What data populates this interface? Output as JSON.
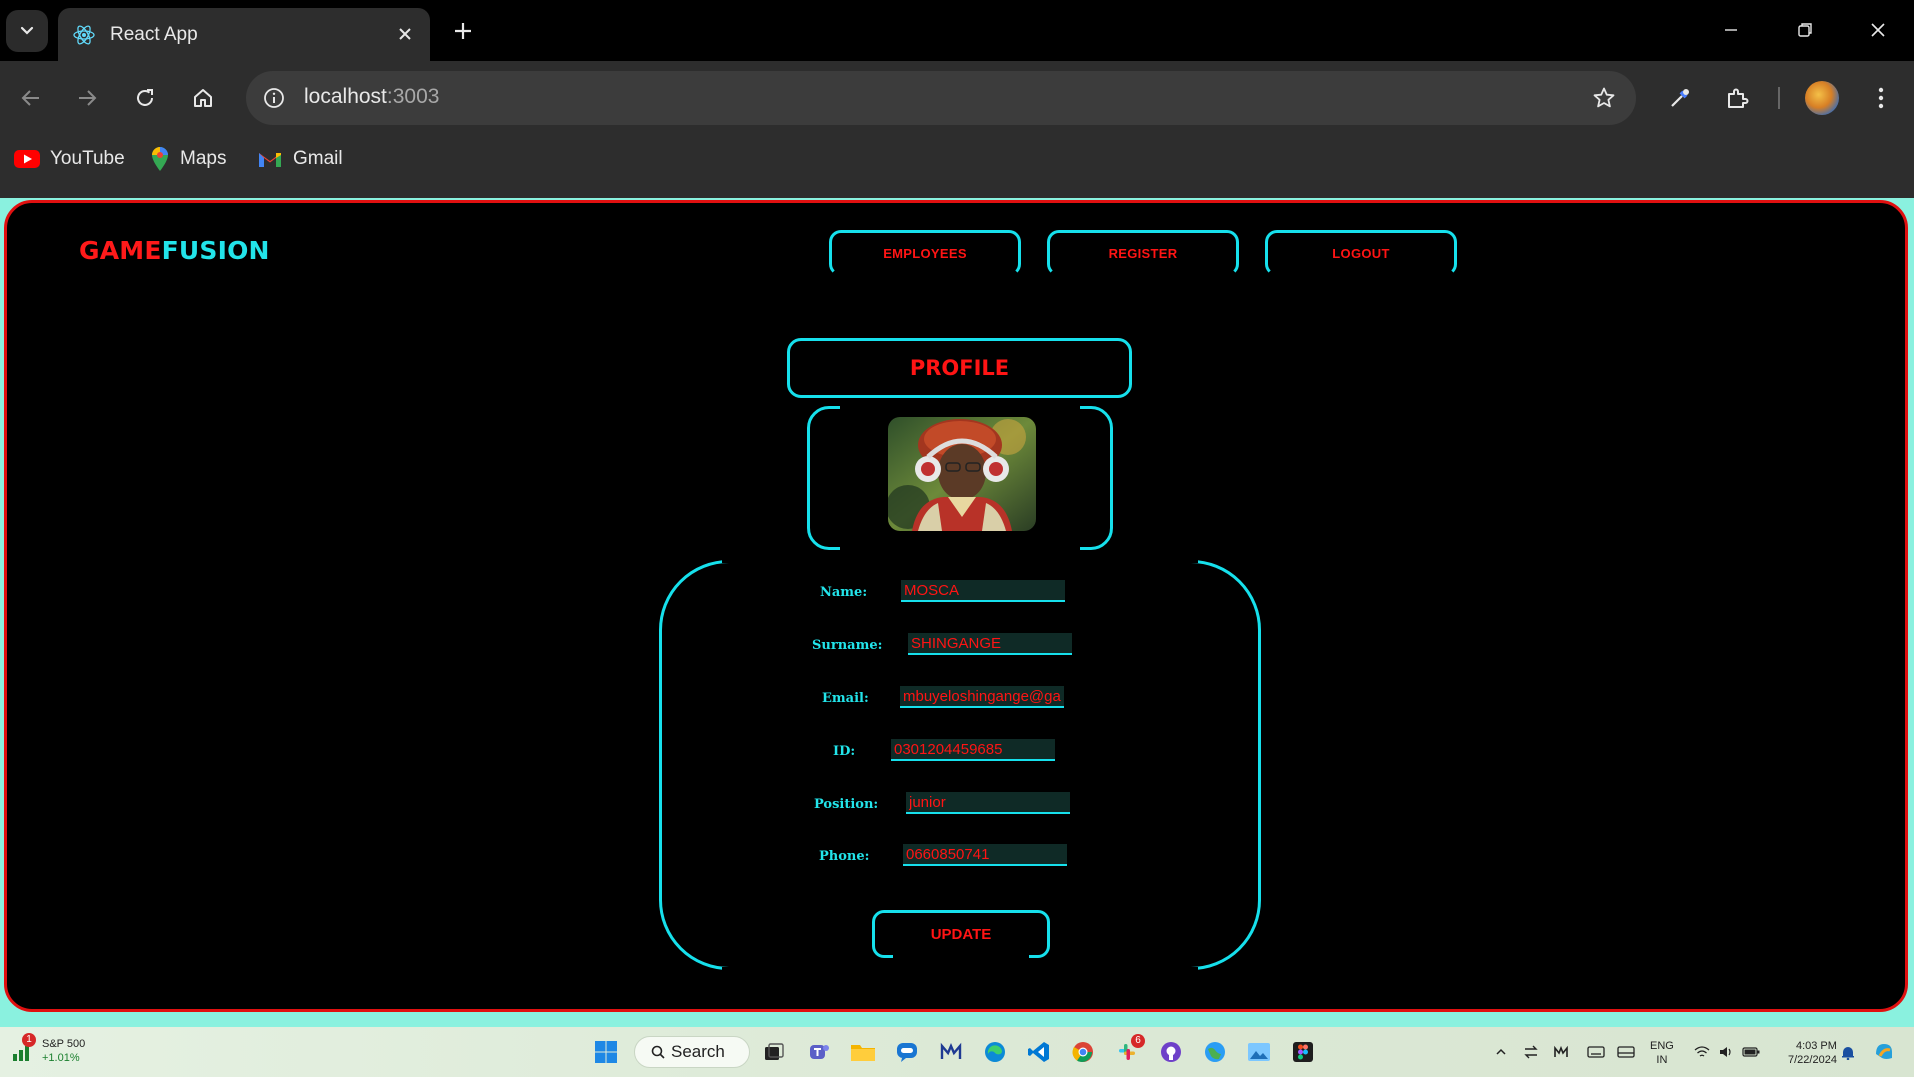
{
  "browser": {
    "tab_title": "React App",
    "url_host": "localhost",
    "url_port": ":3003",
    "bookmarks": [
      {
        "label": "YouTube",
        "icon": "youtube-icon"
      },
      {
        "label": "Maps",
        "icon": "maps-icon"
      },
      {
        "label": "Gmail",
        "icon": "gmail-icon"
      }
    ]
  },
  "app": {
    "brand_part1": "GAME",
    "brand_part2": "FUSION",
    "nav": {
      "employees": "EMPLOYEES",
      "register": "REGISTER",
      "logout": "LOGOUT"
    },
    "profile_title": "PROFILE",
    "fields": {
      "name_label": "Name:",
      "name_value": "MOSCA",
      "surname_label": "Surname:",
      "surname_value": "SHINGANGE",
      "email_label": "Email:",
      "email_value": "mbuyeloshingange@gamil.com",
      "id_label": "ID:",
      "id_value": "0301204459685",
      "position_label": "Position:",
      "position_value": "junior",
      "phone_label": "Phone:",
      "phone_value": "0660850741"
    },
    "update_label": "UPDATE"
  },
  "colors": {
    "accent_cyan": "#16e0ec",
    "accent_red": "#ff1414",
    "page_bg": "#000000",
    "viewport_bg": "#8af1df"
  },
  "taskbar": {
    "widget_name": "S&P 500",
    "widget_change": "+1.01%",
    "widget_badge": "1",
    "search_label": "Search",
    "lang_top": "ENG",
    "lang_bottom": "IN",
    "time": "4:03 PM",
    "date": "7/22/2024",
    "slack_badge": "6"
  }
}
